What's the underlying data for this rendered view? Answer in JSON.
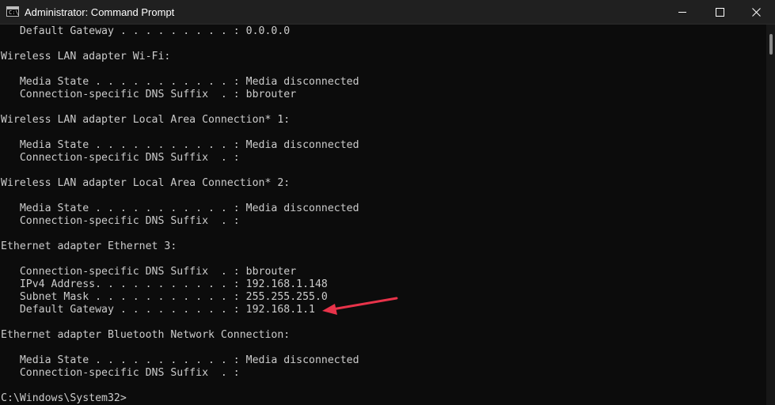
{
  "window": {
    "title": "Administrator: Command Prompt",
    "icon_label": "C:\\"
  },
  "controls": {
    "minimize_icon": "minimize-icon",
    "maximize_icon": "maximize-icon",
    "close_icon": "close-icon"
  },
  "console": {
    "lines": [
      "   Default Gateway . . . . . . . . . : 0.0.0.0",
      "",
      "Wireless LAN adapter Wi-Fi:",
      "",
      "   Media State . . . . . . . . . . . : Media disconnected",
      "   Connection-specific DNS Suffix  . : bbrouter",
      "",
      "Wireless LAN adapter Local Area Connection* 1:",
      "",
      "   Media State . . . . . . . . . . . : Media disconnected",
      "   Connection-specific DNS Suffix  . :",
      "",
      "Wireless LAN adapter Local Area Connection* 2:",
      "",
      "   Media State . . . . . . . . . . . : Media disconnected",
      "   Connection-specific DNS Suffix  . :",
      "",
      "Ethernet adapter Ethernet 3:",
      "",
      "   Connection-specific DNS Suffix  . : bbrouter",
      "   IPv4 Address. . . . . . . . . . . : 192.168.1.148",
      "   Subnet Mask . . . . . . . . . . . : 255.255.255.0",
      "   Default Gateway . . . . . . . . . : 192.168.1.1",
      "",
      "Ethernet adapter Bluetooth Network Connection:",
      "",
      "   Media State . . . . . . . . . . . : Media disconnected",
      "   Connection-specific DNS Suffix  . :",
      "",
      "C:\\Windows\\System32>"
    ]
  },
  "annotation": {
    "color": "#e8334a",
    "icon": "arrow-icon"
  },
  "colors": {
    "console_background": "#0c0c0c",
    "console_text": "#cccccc",
    "titlebar_background": "#202020"
  }
}
